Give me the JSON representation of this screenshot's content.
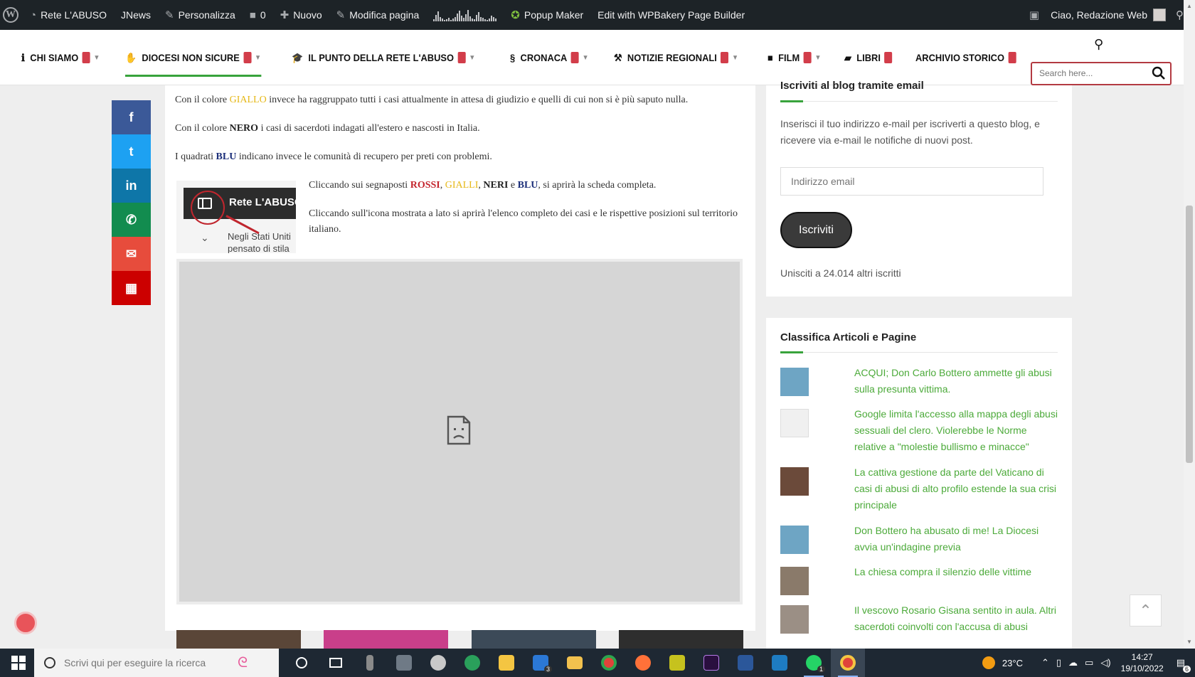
{
  "adminbar": {
    "site_name": "Rete L'ABUSO",
    "jnews": "JNews",
    "customize": "Personalizza",
    "comments_count": "0",
    "new": "Nuovo",
    "edit_page": "Modifica pagina",
    "popup_maker": "Popup Maker",
    "wpbakery": "Edit with WPBakery Page Builder",
    "greeting": "Ciao, Redazione Web"
  },
  "nav": {
    "items": [
      {
        "label": "CHI SIAMO",
        "icon": "info-icon",
        "dropdown": true
      },
      {
        "label": "DIOCESI NON SICURE",
        "icon": "hand-icon",
        "dropdown": true,
        "active": true
      },
      {
        "label": "IL PUNTO DELLA RETE L'ABUSO",
        "icon": "graduation-cap-icon",
        "dropdown": true
      },
      {
        "label": "CRONACA",
        "icon": "spiral-icon",
        "dropdown": true
      },
      {
        "label": "NOTIZIE REGIONALI",
        "icon": "wrench-icon",
        "dropdown": true
      },
      {
        "label": "FILM",
        "icon": "video-camera-icon",
        "dropdown": true
      },
      {
        "label": "LIBRI",
        "icon": "book-icon",
        "dropdown": false
      },
      {
        "label": "ARCHIVIO STORICO",
        "icon": "",
        "dropdown": false
      }
    ],
    "search_placeholder": "Search here..."
  },
  "article": {
    "p1": {
      "pre": "Con il colore ",
      "hl": "GIALLO",
      "post": " invece ha raggruppato tutti i casi attualmente in attesa di giudizio e quelli di cui non si è più saputo nulla."
    },
    "p2": {
      "pre": "Con il colore ",
      "hl": "NERO",
      "post": " i casi di sacerdoti indagati all'estero e nascosti in Italia."
    },
    "p3": {
      "pre": "I quadrati ",
      "hl": "BLU",
      "post": " indicano invece le comunità di recupero per preti con problemi."
    },
    "p4": {
      "pre": "Cliccando sui segnaposti ",
      "red": "ROSSI",
      "sep1": ", ",
      "yellow": "GIALLI",
      "sep2": ", ",
      "black": "NERI",
      "sep3": " e ",
      "blue": "BLU",
      "post": ", si aprirà la scheda completa."
    },
    "p5": "Cliccando sull'icona mostrata a lato si aprirà l'elenco completo dei casi e le rispettive posizioni sul territorio italiano.",
    "inset_title": "Rete L'ABUSO",
    "inset_line1": "Negli Stati Uniti",
    "inset_line2": "pensato di stila"
  },
  "share": [
    {
      "name": "facebook",
      "label": "f",
      "color": "#3b5998"
    },
    {
      "name": "twitter",
      "label": "t",
      "color": "#1da1f2"
    },
    {
      "name": "linkedin",
      "label": "in",
      "color": "#0e76a8"
    },
    {
      "name": "whatsapp",
      "label": "✆",
      "color": "#128c4f"
    },
    {
      "name": "email",
      "label": "✉",
      "color": "#e74c3c"
    },
    {
      "name": "qrcode",
      "label": "▦",
      "color": "#cc0000"
    }
  ],
  "subscribe_widget": {
    "title": "Iscriviti al blog tramite email",
    "description": "Inserisci il tuo indirizzo e-mail per iscriverti a questo blog, e ricevere via e-mail le notifiche di nuovi post.",
    "email_placeholder": "Indirizzo email",
    "button": "Iscriviti",
    "subscribers": "Unisciti a 24.014 altri iscritti"
  },
  "ranking_widget": {
    "title": "Classifica Articoli e Pagine",
    "items": [
      "ACQUI; Don Carlo Bottero ammette gli abusi sulla presunta vittima.",
      "Google limita l'accesso alla mappa degli abusi sessuali del clero. Violerebbe le Norme relative a \"molestie bullismo e minacce\"",
      "La cattiva gestione da parte del Vaticano di casi di abusi di alto profilo estende la sua crisi principale",
      "Don Bottero ha abusato di me! La Diocesi avvia un'indagine previa",
      "La chiesa compra il silenzio delle vittime",
      "Il vescovo Rosario Gisana sentito in aula. Altri sacerdoti coinvolti con l'accusa di abusi"
    ]
  },
  "taskbar": {
    "search_placeholder": "Scrivi qui per eseguire la ricerca",
    "weather": "23°C",
    "time": "14:27",
    "date": "19/10/2022",
    "mail_badge": "3",
    "whatsapp_badge": "1",
    "notifications": "6"
  },
  "colors": {
    "accent_green": "#38a33c",
    "link_green": "#4caa3a",
    "badge_red": "#d23d4a",
    "adminbar": "#1d2327"
  }
}
